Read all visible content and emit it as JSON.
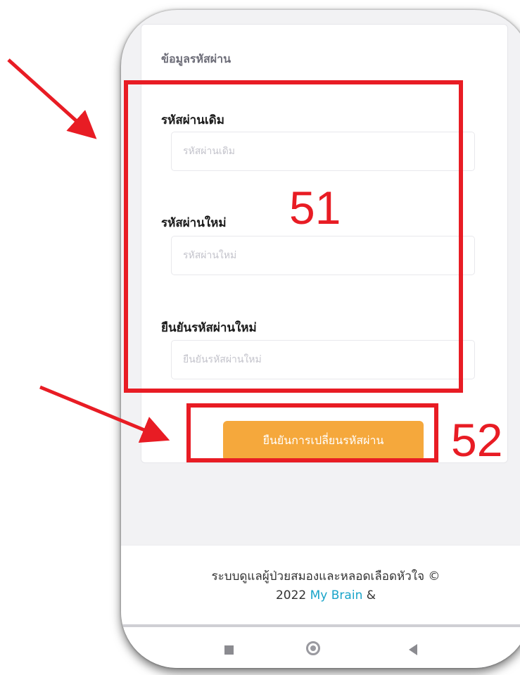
{
  "section_title": "ข้อมูลรหัสผ่าน",
  "fields": [
    {
      "label": "รหัสผ่านเดิม",
      "placeholder": "รหัสผ่านเดิม"
    },
    {
      "label": "รหัสผ่านใหม่",
      "placeholder": "รหัสผ่านใหม่"
    },
    {
      "label": "ยืนยันรหัสผ่านใหม่",
      "placeholder": "ยืนยันรหัสผ่านใหม่"
    }
  ],
  "submit_label": "ยืนยันการเปลี่ยนรหัสผ่าน",
  "footer": {
    "line1": "ระบบดูแลผู้ป่วยสมองและหลอดเลือดหัวใจ ©",
    "year": "2022",
    "brand": "My Brain",
    "suffix": "&"
  },
  "annotations": {
    "fields_number": "51",
    "button_number": "52"
  },
  "navbar": {
    "icons": [
      "recent-apps-icon",
      "home-icon",
      "back-icon"
    ]
  },
  "colors": {
    "button": "#f5a83c",
    "annotation": "#e81c24",
    "link": "#19a4c9"
  }
}
